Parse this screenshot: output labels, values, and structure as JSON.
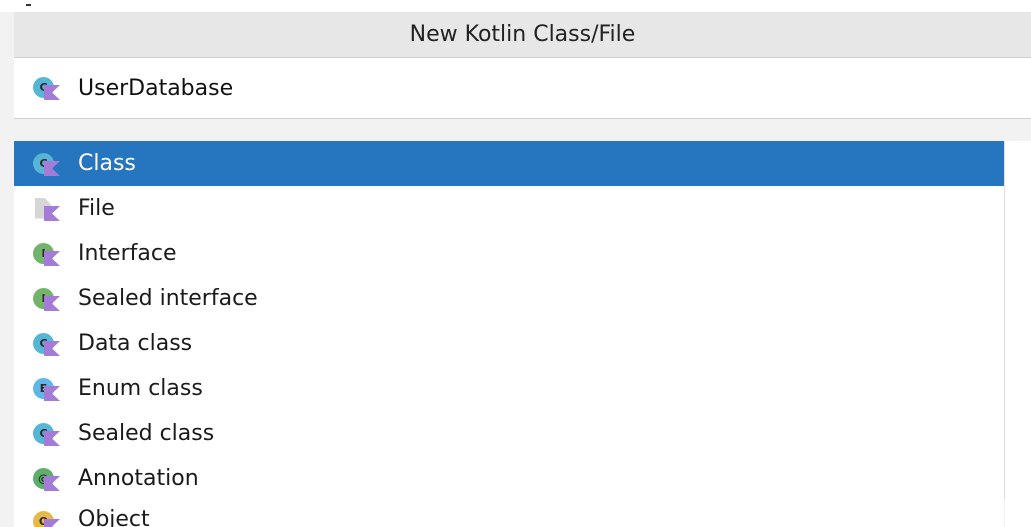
{
  "dialog": {
    "title": "New Kotlin Class/File",
    "name_value": "UserDatabase",
    "name_icon": "kotlin-class-icon"
  },
  "colors": {
    "selection": "#2675bf",
    "class_badge": "#56b6d6",
    "interface_badge": "#74b36b",
    "enum_badge": "#5fb7e8",
    "annotation_badge": "#5cae6a",
    "object_badge": "#e6b94a",
    "kotlin_accent": "#a57bd8"
  },
  "items": [
    {
      "label": "Class",
      "icon": "kotlin-class-icon",
      "letter": "C",
      "selected": true
    },
    {
      "label": "File",
      "icon": "kotlin-file-icon",
      "letter": "",
      "selected": false
    },
    {
      "label": "Interface",
      "icon": "kotlin-interface-icon",
      "letter": "I",
      "selected": false
    },
    {
      "label": "Sealed interface",
      "icon": "kotlin-interface-icon",
      "letter": "I",
      "selected": false
    },
    {
      "label": "Data class",
      "icon": "kotlin-class-icon",
      "letter": "C",
      "selected": false
    },
    {
      "label": "Enum class",
      "icon": "kotlin-enum-icon",
      "letter": "E",
      "selected": false
    },
    {
      "label": "Sealed class",
      "icon": "kotlin-class-icon",
      "letter": "C",
      "selected": false
    },
    {
      "label": "Annotation",
      "icon": "kotlin-annotation-icon",
      "letter": "@",
      "selected": false
    },
    {
      "label": "Object",
      "icon": "kotlin-object-icon",
      "letter": "O",
      "selected": false
    }
  ]
}
